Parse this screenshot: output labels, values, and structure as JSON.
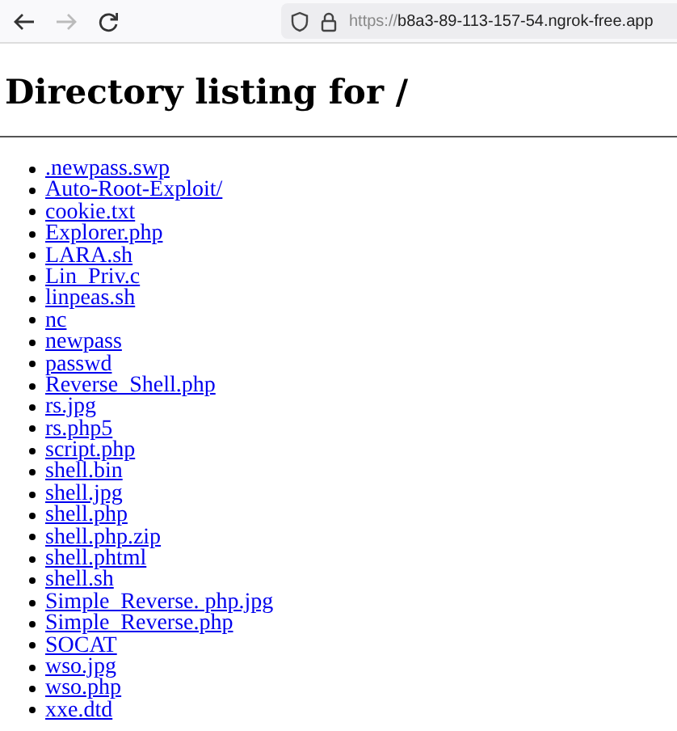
{
  "toolbar": {
    "back_enabled": true,
    "forward_enabled": false,
    "url_scheme": "https://",
    "url_host": "b8a3-89-113-157-54.ngrok-free.app"
  },
  "heading": "Directory listing for /",
  "files": [
    ".newpass.swp",
    "Auto-Root-Exploit/",
    "cookie.txt",
    "Explorer.php",
    "LARA.sh",
    "Lin_Priv.c",
    "linpeas.sh",
    "nc",
    "newpass",
    "passwd",
    "Reverse_Shell.php",
    "rs.jpg",
    "rs.php5",
    "script.php",
    "shell.bin",
    "shell.jpg",
    "shell.php",
    "shell.php.zip",
    "shell.phtml",
    "shell.sh",
    "Simple_Reverse. php.jpg",
    "Simple_Reverse.php",
    "SOCAT",
    "wso.jpg",
    "wso.php",
    "xxe.dtd"
  ]
}
